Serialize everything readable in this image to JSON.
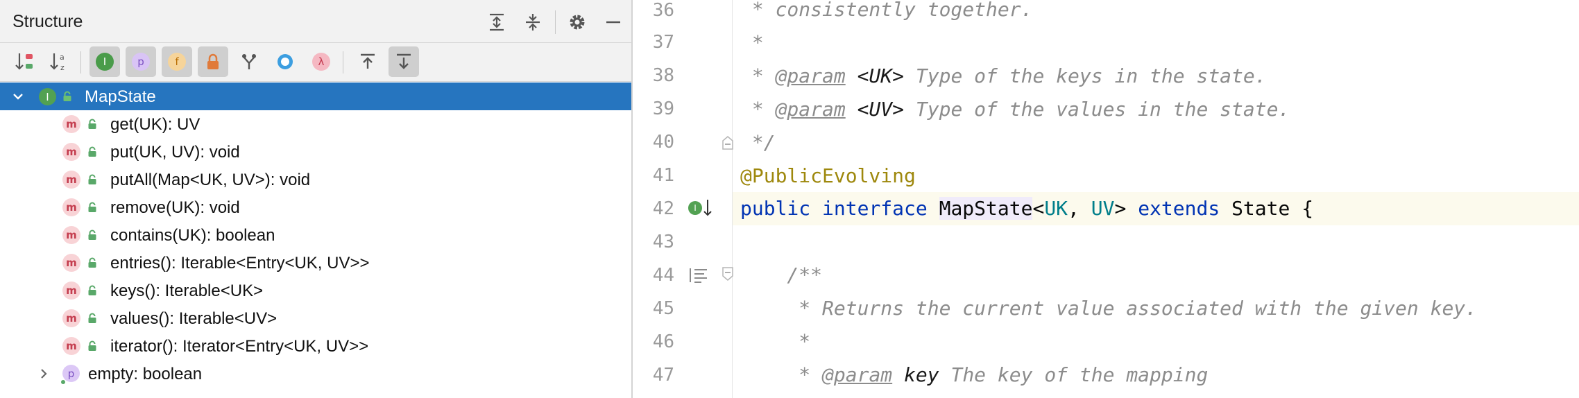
{
  "structure_panel": {
    "title": "Structure",
    "header_icons": [
      "expand-all-icon",
      "collapse-all-icon",
      "gear-icon",
      "minimize-icon"
    ],
    "toolbar": [
      {
        "name": "sort-by-visibility-icon",
        "glyph": "↓",
        "active": false
      },
      {
        "name": "sort-alphabetically-icon",
        "glyph": "↓",
        "active": false
      },
      {
        "name": "show-inherited-icon",
        "glyph": "I",
        "active": true
      },
      {
        "name": "show-properties-icon",
        "glyph": "p",
        "active": true
      },
      {
        "name": "show-fields-icon",
        "glyph": "f",
        "active": true
      },
      {
        "name": "show-non-public-icon",
        "glyph": "",
        "active": true
      },
      {
        "name": "show-implemented-interfaces-icon",
        "glyph": "Y",
        "active": false
      },
      {
        "name": "show-anonymous-classes-icon",
        "glyph": "",
        "active": false
      },
      {
        "name": "show-lambdas-icon",
        "glyph": "λ",
        "active": false
      },
      {
        "name": "autoscroll-to-source-icon",
        "glyph": "",
        "active": false
      },
      {
        "name": "autoscroll-from-source-icon",
        "glyph": "",
        "active": true
      }
    ],
    "tree": {
      "root": {
        "label": "MapState",
        "badge": "I"
      },
      "methods": [
        "get(UK): UV",
        "put(UK, UV): void",
        "putAll(Map<UK, UV>): void",
        "remove(UK): void",
        "contains(UK): boolean",
        "entries(): Iterable<Entry<UK, UV>>",
        "keys(): Iterable<UK>",
        "values(): Iterable<UV>",
        "iterator(): Iterator<Entry<UK, UV>>"
      ],
      "method_badge": "m",
      "property": {
        "label": "empty: boolean",
        "badge": "p"
      }
    }
  },
  "editor": {
    "line_numbers": [
      "36",
      "37",
      "38",
      "39",
      "40",
      "41",
      "42",
      "43",
      "44",
      "45",
      "46",
      "47"
    ],
    "lines": {
      "l36": " * consistently together.",
      "l37": " *",
      "l38": {
        "star": " * ",
        "tag": "@param",
        "name": " <UK>",
        "text": " Type of the keys in the state."
      },
      "l39": {
        "star": " * ",
        "tag": "@param",
        "name": " <UV>",
        "text": " Type of the values in the state."
      },
      "l40": " */",
      "l41": "@PublicEvolving",
      "l42": {
        "kw1": "public",
        "kw2": "interface",
        "cls": "MapState",
        "lt": "<",
        "t1": "UK",
        "comma": ", ",
        "t2": "UV",
        "gt": ">",
        "kw3": "extends",
        "sup": "State",
        "brace": " {"
      },
      "l43": "",
      "l44": "    /**",
      "l45": "     * Returns the current value associated with the given key.",
      "l46": "     *",
      "l47": {
        "star": "     * ",
        "tag": "@param",
        "name": " key",
        "text": " The key of the mapping"
      }
    }
  }
}
